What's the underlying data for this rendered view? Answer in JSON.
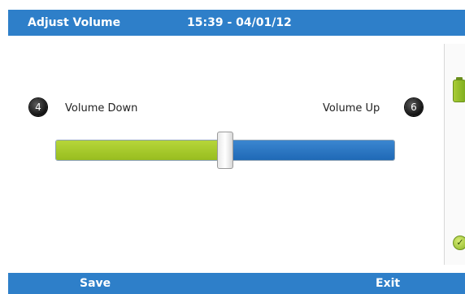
{
  "header": {
    "title": "Adjust Volume",
    "datetime": "15:39 - 04/01/12"
  },
  "volume": {
    "down_key": "4",
    "down_label": "Volume Down",
    "up_key": "6",
    "up_label": "Volume Up",
    "level_fraction": 0.5
  },
  "side_panel": {
    "icons": [
      "battery-icon",
      "check-icon"
    ]
  },
  "footer": {
    "left_softkey": "Save",
    "right_softkey": "Exit"
  },
  "colors": {
    "bar_blue": "#2e7fc9",
    "slider_green": "#9ec324",
    "slider_blue": "#2a76c4"
  }
}
